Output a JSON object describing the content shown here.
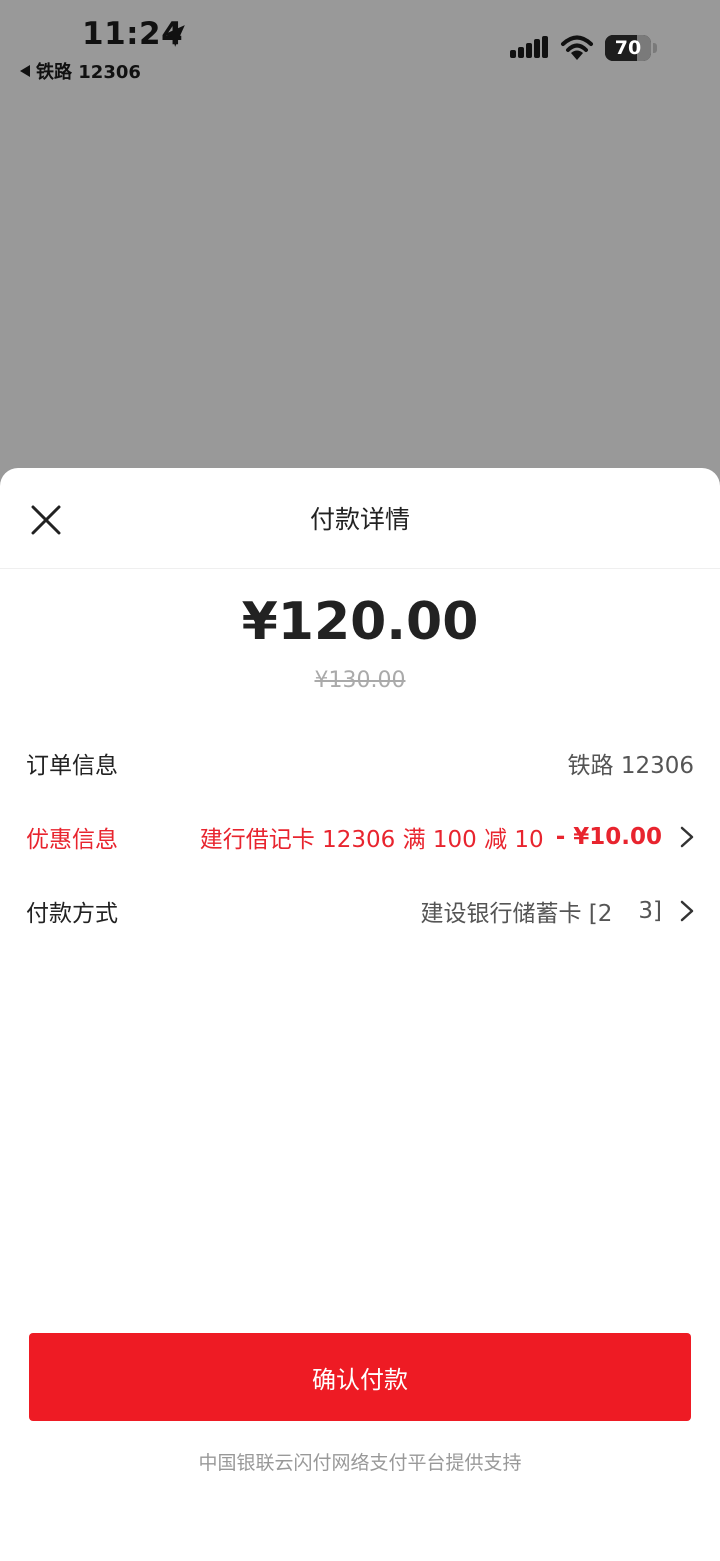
{
  "status_bar": {
    "time": "11:24",
    "back_app": "铁路 12306",
    "battery_percent": 70
  },
  "sheet": {
    "title": "付款详情",
    "amount": "¥120.00",
    "original_amount": "¥130.00",
    "rows": {
      "order": {
        "label": "订单信息",
        "value": "铁路 12306"
      },
      "promo": {
        "label": "优惠信息",
        "description": "建行借记卡 12306 满 100 减 10",
        "amount": "- ¥10.00"
      },
      "payment": {
        "label": "付款方式",
        "value_prefix": "建设银行储蓄卡 [2",
        "value_suffix": "3]"
      }
    },
    "confirm_label": "确认付款",
    "footer": "中国银联云闪付网络支付平台提供支持"
  },
  "colors": {
    "accent": "#ee1b24",
    "promo_text": "#e8242e",
    "overlay": "#999999"
  }
}
